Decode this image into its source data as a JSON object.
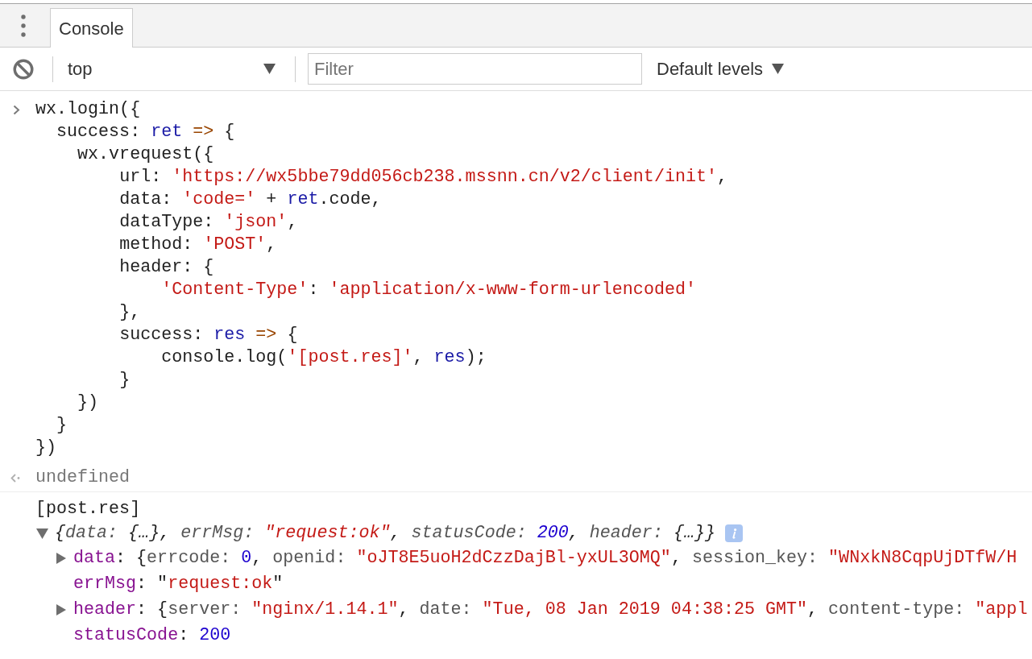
{
  "tab_bar": {
    "tabs": [
      {
        "label": "Console",
        "selected": true
      }
    ]
  },
  "toolbar": {
    "context": "top",
    "filter": {
      "placeholder": "Filter"
    },
    "levels": "Default levels"
  },
  "console": {
    "input": [
      [
        {
          "text": "wx.login({",
          "kind": "plain"
        }
      ],
      [
        {
          "text": "  success: ",
          "kind": "plain"
        },
        {
          "text": "ret",
          "kind": "variable"
        },
        {
          "text": " => ",
          "kind": "operator"
        },
        {
          "text": "{",
          "kind": "plain"
        }
      ],
      [
        {
          "text": "    wx.vrequest({",
          "kind": "plain"
        }
      ],
      [
        {
          "text": "        url: ",
          "kind": "plain"
        },
        {
          "text": "'https://wx5bbe79dd056cb238.mssnn.cn/v2/client/init'",
          "kind": "string"
        },
        {
          "text": ",",
          "kind": "plain"
        }
      ],
      [
        {
          "text": "        data: ",
          "kind": "plain"
        },
        {
          "text": "'code='",
          "kind": "string"
        },
        {
          "text": " + ",
          "kind": "plain"
        },
        {
          "text": "ret",
          "kind": "variable"
        },
        {
          "text": ".code,",
          "kind": "plain"
        }
      ],
      [
        {
          "text": "        dataType: ",
          "kind": "plain"
        },
        {
          "text": "'json'",
          "kind": "string"
        },
        {
          "text": ",",
          "kind": "plain"
        }
      ],
      [
        {
          "text": "        method: ",
          "kind": "plain"
        },
        {
          "text": "'POST'",
          "kind": "string"
        },
        {
          "text": ",",
          "kind": "plain"
        }
      ],
      [
        {
          "text": "        header: {",
          "kind": "plain"
        }
      ],
      [
        {
          "text": "            'Content-Type'",
          "kind": "string"
        },
        {
          "text": ": ",
          "kind": "plain"
        },
        {
          "text": "'application/x-www-form-urlencoded'",
          "kind": "string"
        }
      ],
      [
        {
          "text": "        },",
          "kind": "plain"
        }
      ],
      [
        {
          "text": "        success: ",
          "kind": "plain"
        },
        {
          "text": "res",
          "kind": "variable"
        },
        {
          "text": " => ",
          "kind": "operator"
        },
        {
          "text": "{",
          "kind": "plain"
        }
      ],
      [
        {
          "text": "            console.log(",
          "kind": "plain"
        },
        {
          "text": "'[post.res]'",
          "kind": "string"
        },
        {
          "text": ", ",
          "kind": "plain"
        },
        {
          "text": "res",
          "kind": "variable"
        },
        {
          "text": ");",
          "kind": "plain"
        }
      ],
      [
        {
          "text": "        }",
          "kind": "plain"
        }
      ],
      [
        {
          "text": "    })",
          "kind": "plain"
        }
      ],
      [
        {
          "text": "  }",
          "kind": "plain"
        }
      ],
      [
        {
          "text": "})",
          "kind": "plain"
        }
      ]
    ],
    "result": "undefined",
    "log": {
      "label": "[post.res]",
      "object": {
        "expanded": true,
        "preview": [
          {
            "text": "{",
            "kind": "plain"
          },
          {
            "text": "data: ",
            "kind": "key"
          },
          {
            "text": "{…}, ",
            "kind": "plain"
          },
          {
            "text": "errMsg: ",
            "kind": "key"
          },
          {
            "text": "\"request:ok\"",
            "kind": "string"
          },
          {
            "text": ", ",
            "kind": "plain"
          },
          {
            "text": "statusCode: ",
            "kind": "key"
          },
          {
            "text": "200",
            "kind": "number"
          },
          {
            "text": ", ",
            "kind": "plain"
          },
          {
            "text": "header: ",
            "kind": "key"
          },
          {
            "text": "{…}}",
            "kind": "plain"
          }
        ],
        "children": [
          {
            "kind": "object",
            "name": "data",
            "expanded": false,
            "value": [
              {
                "text": ": {",
                "kind": "plain"
              },
              {
                "text": "errcode: ",
                "kind": "key"
              },
              {
                "text": "0",
                "kind": "number"
              },
              {
                "text": ", ",
                "kind": "plain"
              },
              {
                "text": "openid: ",
                "kind": "key"
              },
              {
                "text": "\"oJT8E5uoH2dCzzDajBl-yxUL3OMQ\"",
                "kind": "string"
              },
              {
                "text": ", ",
                "kind": "plain"
              },
              {
                "text": "session_key: ",
                "kind": "key"
              },
              {
                "text": "\"WNxkN8CqpUjDTfW/H",
                "kind": "string"
              }
            ]
          },
          {
            "kind": "value",
            "name": "errMsg",
            "value": [
              {
                "text": ": \"",
                "kind": "plain"
              },
              {
                "text": "request:ok",
                "kind": "string"
              },
              {
                "text": "\"",
                "kind": "plain"
              }
            ]
          },
          {
            "kind": "object",
            "name": "header",
            "expanded": false,
            "value": [
              {
                "text": ": {",
                "kind": "plain"
              },
              {
                "text": "server: ",
                "kind": "key"
              },
              {
                "text": "\"nginx/1.14.1\"",
                "kind": "string"
              },
              {
                "text": ", ",
                "kind": "plain"
              },
              {
                "text": "date: ",
                "kind": "key"
              },
              {
                "text": "\"Tue, 08 Jan 2019 04:38:25 GMT\"",
                "kind": "string"
              },
              {
                "text": ", ",
                "kind": "plain"
              },
              {
                "text": "content-type: ",
                "kind": "key"
              },
              {
                "text": "\"appl",
                "kind": "string"
              }
            ]
          },
          {
            "kind": "value",
            "name": "statusCode",
            "value": [
              {
                "text": ": ",
                "kind": "plain"
              },
              {
                "text": "200",
                "kind": "number"
              }
            ]
          }
        ]
      }
    }
  }
}
